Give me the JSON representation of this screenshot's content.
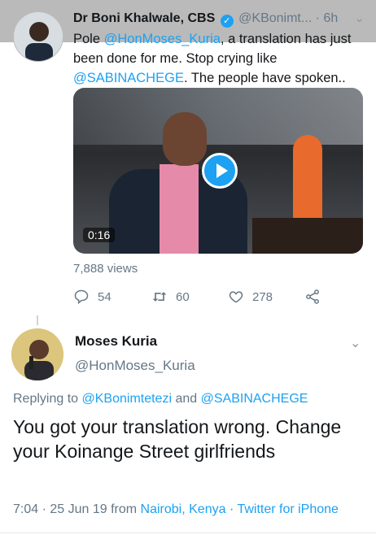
{
  "tweet1": {
    "author_name": "Dr Boni Khalwale, CBS",
    "handle": "@KBonimt...",
    "time": "· 6h",
    "text_parts": [
      "Pole ",
      "@HonMoses_Kuria",
      ", a translation has just been done for me. Stop crying like ",
      "@SABINACHEGE",
      ". The people have spoken.."
    ],
    "video_duration": "0:16",
    "views": "7,888 views",
    "replies": "54",
    "retweets": "60",
    "likes": "278"
  },
  "tweet2": {
    "author_name": "Moses Kuria",
    "handle": "@HonMoses_Kuria",
    "replying_label": "Replying to",
    "replying_user1": "@KBonimtetezi",
    "replying_and": "and",
    "replying_user2": "@SABINACHEGE",
    "text": "You got your translation wrong. Change your Koinange Street girlfriends",
    "time_date": "7:04 · 25 Jun 19 from",
    "location": "Nairobi, Kenya",
    "separator": "·",
    "client": "Twitter for iPhone"
  },
  "colors": {
    "link": "#1da1f2",
    "muted": "#657786",
    "text": "#14171a"
  },
  "icons": {
    "verified": "verified-badge-icon",
    "caret": "chevron-down-icon",
    "reply": "reply-icon",
    "retweet": "retweet-icon",
    "like": "heart-icon",
    "share": "share-icon",
    "play": "play-icon"
  }
}
